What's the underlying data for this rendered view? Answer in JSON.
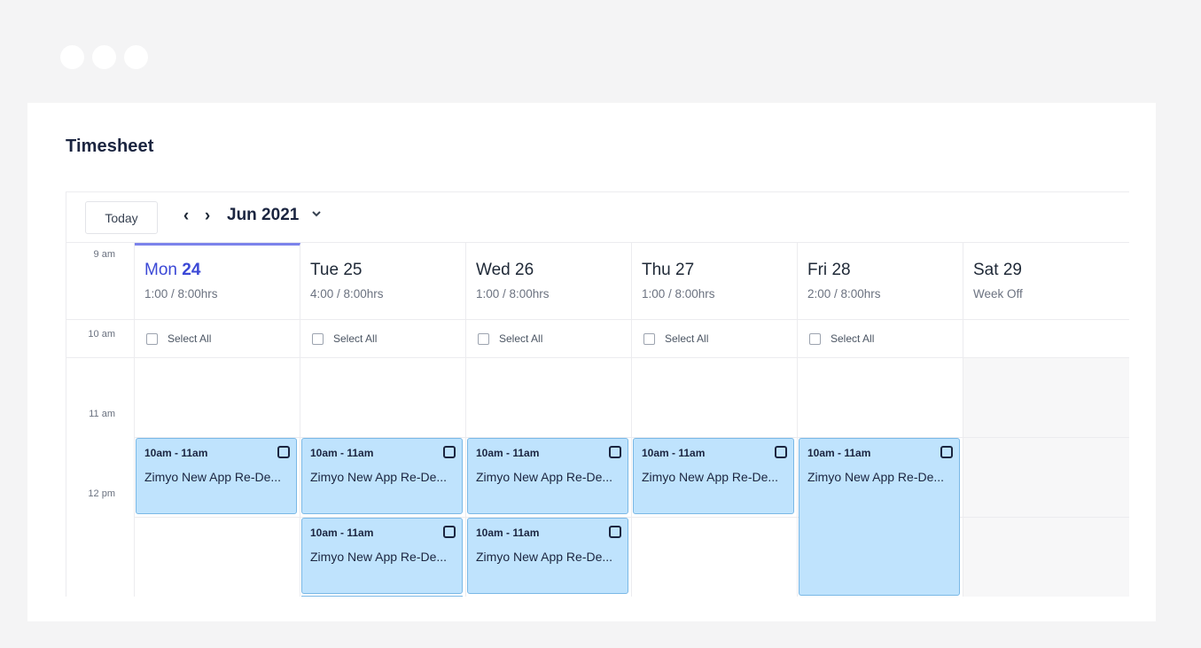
{
  "page": {
    "title": "Timesheet"
  },
  "toolbar": {
    "today_label": "Today",
    "prev_icon": "chevron-left-icon",
    "next_icon": "chevron-right-icon",
    "month_label": "Jun 2021",
    "dropdown_icon": "chevron-down-icon"
  },
  "days": [
    {
      "day": "Mon",
      "num": "24",
      "hours": "1:00 / 8:00hrs",
      "select_all": "Select All",
      "active": true
    },
    {
      "day": "Tue",
      "num": "25",
      "hours": "4:00 / 8:00hrs",
      "select_all": "Select All"
    },
    {
      "day": "Wed",
      "num": "26",
      "hours": "1:00 / 8:00hrs",
      "select_all": "Select All"
    },
    {
      "day": "Thu",
      "num": "27",
      "hours": "1:00 / 8:00hrs",
      "select_all": "Select All"
    },
    {
      "day": "Fri",
      "num": "28",
      "hours": "2:00 / 8:00hrs",
      "select_all": "Select All"
    },
    {
      "day": "Sat",
      "num": "29",
      "hours": "Week Off"
    }
  ],
  "time_labels": [
    "9 am",
    "10 am",
    "11 am",
    "12 pm"
  ],
  "events": [
    {
      "day": "Mon",
      "start": "10am",
      "time": "10am - 11am",
      "title": "Zimyo New App Re-De..."
    },
    {
      "day": "Tue",
      "start": "10am",
      "time": "10am - 11am",
      "title": "Zimyo New App Re-De..."
    },
    {
      "day": "Tue",
      "start": "11am",
      "time": "10am - 11am",
      "title": "Zimyo New App Re-De..."
    },
    {
      "day": "Wed",
      "start": "10am",
      "time": "10am - 11am",
      "title": "Zimyo New App Re-De..."
    },
    {
      "day": "Wed",
      "start": "11am",
      "time": "10am - 11am",
      "title": "Zimyo New App Re-De..."
    },
    {
      "day": "Thu",
      "start": "10am",
      "time": "10am - 11am",
      "title": "Zimyo New App Re-De..."
    },
    {
      "day": "Fri",
      "start": "10am",
      "time": "10am - 11am",
      "title": "Zimyo New App Re-De..."
    }
  ],
  "colors": {
    "accent": "#3b48d6",
    "active_underline": "#7b83eb",
    "event_bg": "#bfe3fd",
    "event_border": "#7ab8e6",
    "window_bg": "#f4f4f5"
  }
}
